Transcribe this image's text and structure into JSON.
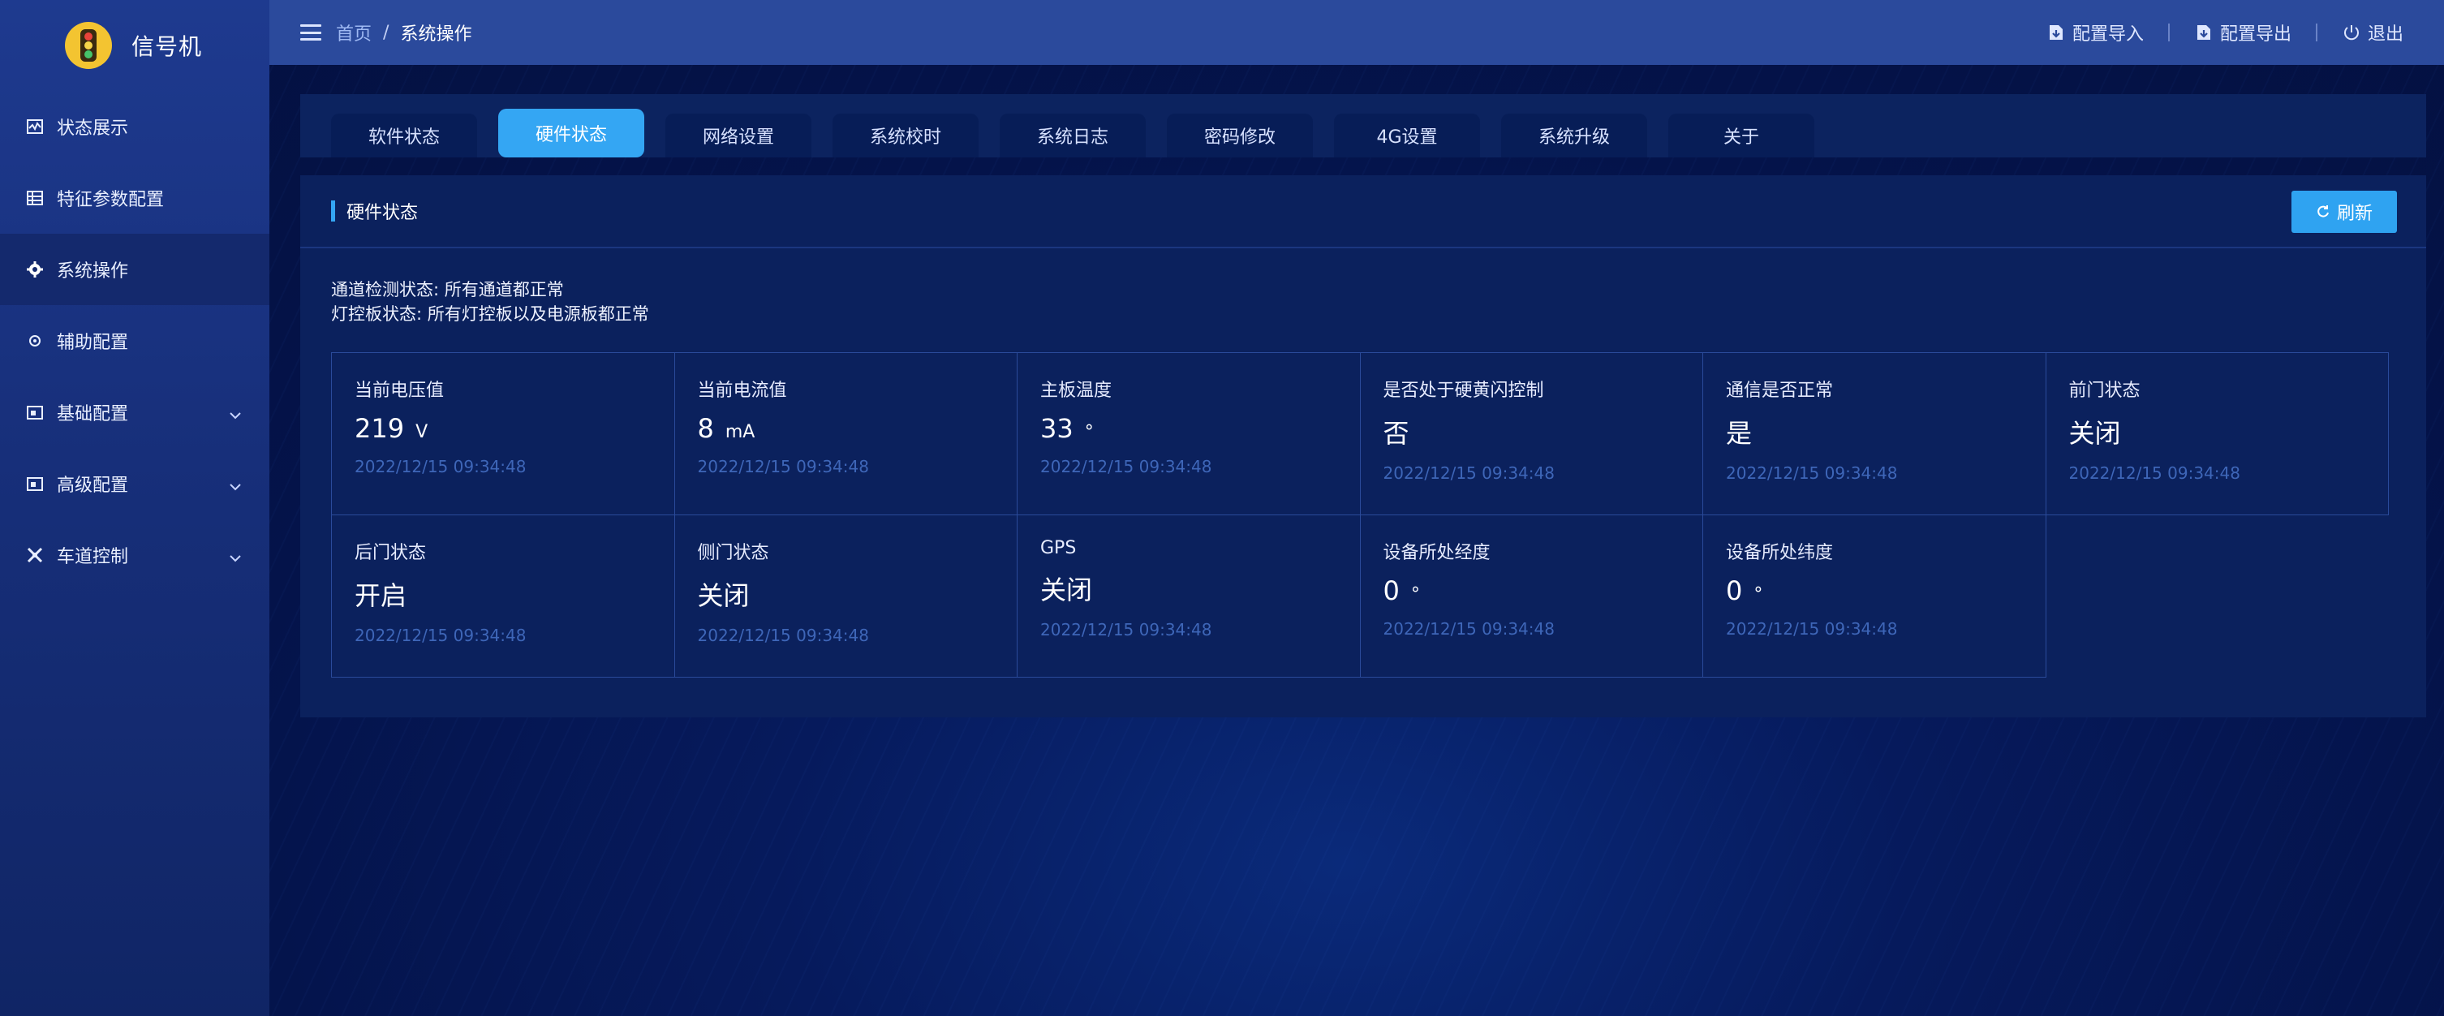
{
  "brand": {
    "title": "信号机",
    "logo_icon": "traffic-light-icon"
  },
  "sidebar": {
    "items": [
      {
        "label": "状态展示",
        "icon": "chart-icon",
        "active": false,
        "expandable": false
      },
      {
        "label": "特征参数配置",
        "icon": "grid-icon",
        "active": false,
        "expandable": false
      },
      {
        "label": "系统操作",
        "icon": "gear-icon",
        "active": true,
        "expandable": false
      },
      {
        "label": "辅助配置",
        "icon": "cog-small-icon",
        "active": false,
        "expandable": false
      },
      {
        "label": "基础配置",
        "icon": "panel-icon",
        "active": false,
        "expandable": true
      },
      {
        "label": "高级配置",
        "icon": "panel-icon",
        "active": false,
        "expandable": true
      },
      {
        "label": "车道控制",
        "icon": "lane-icon",
        "active": false,
        "expandable": true
      }
    ]
  },
  "header": {
    "breadcrumb": {
      "home": "首页",
      "separator": "/",
      "current": "系统操作"
    },
    "actions": {
      "import_label": "配置导入",
      "export_label": "配置导出",
      "logout_label": "退出"
    }
  },
  "tabs": [
    {
      "label": "软件状态",
      "active": false
    },
    {
      "label": "硬件状态",
      "active": true
    },
    {
      "label": "网络设置",
      "active": false
    },
    {
      "label": "系统校时",
      "active": false
    },
    {
      "label": "系统日志",
      "active": false
    },
    {
      "label": "密码修改",
      "active": false
    },
    {
      "label": "4G设置",
      "active": false
    },
    {
      "label": "系统升级",
      "active": false
    },
    {
      "label": "关于",
      "active": false
    }
  ],
  "panel": {
    "title": "硬件状态",
    "refresh_label": "刷新",
    "status_lines": [
      "通道检测状态: 所有通道都正常",
      "灯控板状态: 所有灯控板以及电源板都正常"
    ],
    "cards": [
      {
        "label": "当前电压值",
        "value": "219",
        "unit": "V",
        "time": "2022/12/15 09:34:48"
      },
      {
        "label": "当前电流值",
        "value": "8",
        "unit": "mA",
        "time": "2022/12/15 09:34:48"
      },
      {
        "label": "主板温度",
        "value": "33",
        "unit": "°",
        "time": "2022/12/15 09:34:48"
      },
      {
        "label": "是否处于硬黄闪控制",
        "value": "否",
        "unit": "",
        "time": "2022/12/15 09:34:48"
      },
      {
        "label": "通信是否正常",
        "value": "是",
        "unit": "",
        "time": "2022/12/15 09:34:48"
      },
      {
        "label": "前门状态",
        "value": "关闭",
        "unit": "",
        "time": "2022/12/15 09:34:48"
      },
      {
        "label": "后门状态",
        "value": "开启",
        "unit": "",
        "time": "2022/12/15 09:34:48"
      },
      {
        "label": "侧门状态",
        "value": "关闭",
        "unit": "",
        "time": "2022/12/15 09:34:48"
      },
      {
        "label": "GPS",
        "value": "关闭",
        "unit": "",
        "time": "2022/12/15 09:34:48"
      },
      {
        "label": "设备所处经度",
        "value": "0",
        "unit": "°",
        "time": "2022/12/15 09:34:48"
      },
      {
        "label": "设备所处纬度",
        "value": "0",
        "unit": "°",
        "time": "2022/12/15 09:34:48"
      }
    ]
  },
  "colors": {
    "accent": "#34a6f3",
    "sidebar_bg": "#1e3a8f",
    "header_bg": "#2b4a9c",
    "page_bg": "#04134a",
    "timestamp": "#3e66b8"
  }
}
